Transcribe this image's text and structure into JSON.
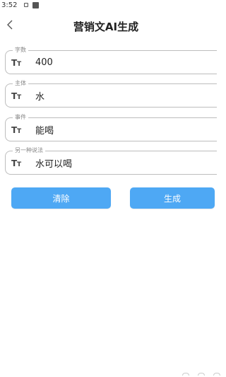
{
  "status_bar": {
    "time": "3:52"
  },
  "header": {
    "title": "营销文AI生成",
    "back_icon": "chevron-left-icon"
  },
  "form": {
    "fields": [
      {
        "label": "字数",
        "value": "400",
        "icon": "text-size-icon"
      },
      {
        "label": "主体",
        "value": "水",
        "icon": "text-size-icon"
      },
      {
        "label": "事件",
        "value": "能喝",
        "icon": "text-size-icon"
      },
      {
        "label": "另一种说法",
        "value": "水可以喝",
        "icon": "text-size-icon"
      }
    ]
  },
  "actions": {
    "clear_label": "清除",
    "generate_label": "生成"
  },
  "colors": {
    "button_bg": "#4ea8f4",
    "field_border": "#bdbdbd"
  }
}
